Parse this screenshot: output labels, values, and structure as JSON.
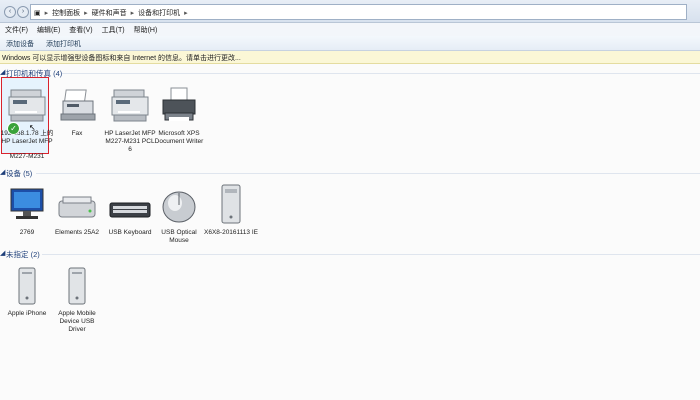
{
  "address": {
    "crumbs": [
      "控制面板",
      "硬件和声音",
      "设备和打印机"
    ]
  },
  "menu": [
    "文件(F)",
    "编辑(E)",
    "查看(V)",
    "工具(T)",
    "帮助(H)"
  ],
  "commands": [
    "添加设备",
    "添加打印机"
  ],
  "infobar": "Windows 可以显示增强型设备图标和来自 Internet 的信息。请单击进行更改...",
  "groups": {
    "printers": {
      "title": "打印机和传真 (4)"
    },
    "devices": {
      "title": "设备 (5)"
    },
    "unspecified": {
      "title": "未指定 (2)"
    }
  },
  "printers": [
    {
      "label": "192.168.1.78 上的 HP LaserJet MFP",
      "extra": "M227-M231",
      "icon": "mfp-printer-icon"
    },
    {
      "label": "Fax",
      "icon": "fax-icon"
    },
    {
      "label": "HP LaserJet MFP M227-M231 PCL 6",
      "icon": "mfp-printer-icon"
    },
    {
      "label": "Microsoft XPS Document Writer",
      "icon": "xps-printer-icon"
    }
  ],
  "devices": [
    {
      "label": "2769",
      "icon": "monitor-icon"
    },
    {
      "label": "Elements 25A2",
      "icon": "hard-drive-icon"
    },
    {
      "label": "USB Keyboard",
      "icon": "keyboard-icon"
    },
    {
      "label": "USB Optical Mouse",
      "icon": "mouse-icon"
    },
    {
      "label": "X6X8-20161113 IE",
      "icon": "pc-tower-icon"
    }
  ],
  "unspecified": [
    {
      "label": "Apple iPhone",
      "icon": "generic-device-icon"
    },
    {
      "label": "Apple Mobile Device USB Driver",
      "icon": "generic-device-icon"
    }
  ],
  "colors": {
    "accent": "#1e3f7a",
    "selection_border": "#d9232d",
    "default_check": "#3aa33a"
  }
}
